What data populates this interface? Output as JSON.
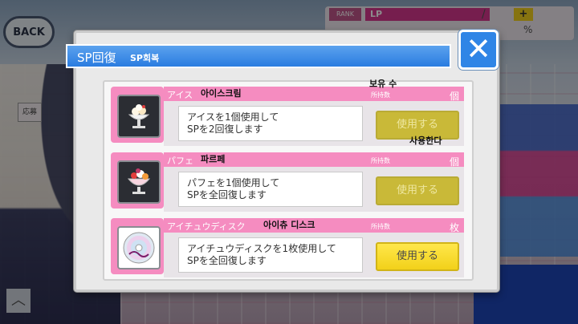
{
  "background": {
    "back_label": "BACK",
    "rank_label": "RANK",
    "lp_label": "LP",
    "plus_label": "+",
    "slash_label": "/",
    "percent_label": "%",
    "side_tag_label": "応募",
    "up_arrow": "︿"
  },
  "dialog": {
    "title": "SP回復",
    "title_ko": "SP회복",
    "close_icon": "✕",
    "stock_header_ko": "보유 수",
    "use_ko": "사용한다"
  },
  "items": [
    {
      "name": "アイス",
      "name_ko": "아이스크림",
      "stock_label": "所持数",
      "unit": "個",
      "desc_line1": "アイスを1個使用して",
      "desc_line2": "SPを2回復します",
      "button": "使用する",
      "button_state": "disabled",
      "icon": "ice-cream-icon"
    },
    {
      "name": "パフェ",
      "name_ko": "파르페",
      "stock_label": "所持数",
      "unit": "個",
      "desc_line1": "パフェを1個使用して",
      "desc_line2": "SPを全回復します",
      "button": "使用する",
      "button_state": "disabled",
      "icon": "parfait-icon"
    },
    {
      "name": "アイチュウディスク",
      "name_ko": "아이츄 디스크",
      "stock_label": "所持数",
      "unit": "枚",
      "desc_line1": "アイチュウディスクを1枚使用して",
      "desc_line2": "SPを全回復します",
      "button": "使用する",
      "button_state": "active",
      "icon": "disc-icon"
    }
  ],
  "colors": {
    "accent_pink": "#f58cc0",
    "title_blue": "#2a7ce0",
    "button_active": "#f2d11a",
    "button_disabled": "#c9b938"
  }
}
